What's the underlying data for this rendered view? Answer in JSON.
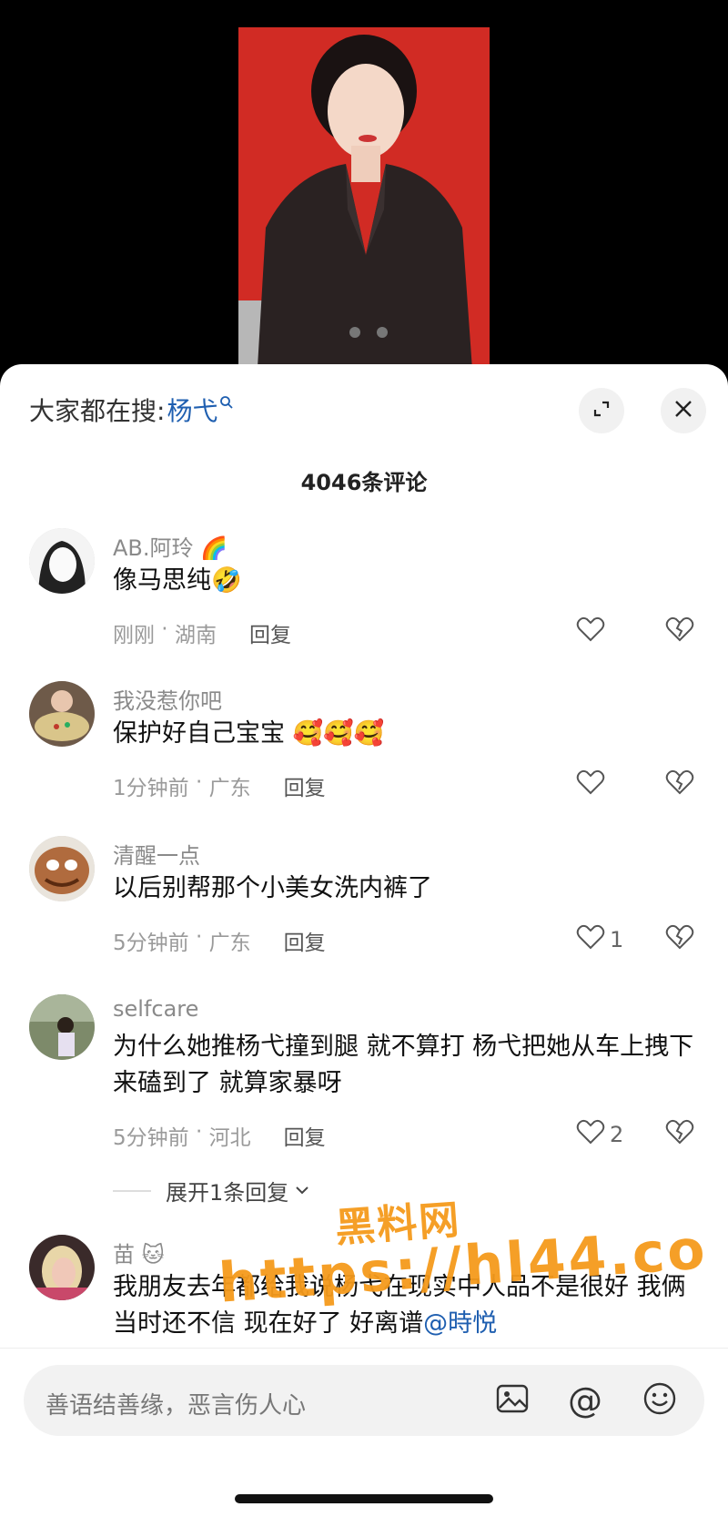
{
  "search": {
    "prefix": "大家都在搜:",
    "keyword": "杨弋"
  },
  "comment_count": "4046条评论",
  "comments": [
    {
      "username": "AB.阿玲",
      "text": "像马思纯",
      "time": "刚刚",
      "location": "湖南",
      "reply": "回复",
      "likes": ""
    },
    {
      "username": "我没惹你吧",
      "text": "保护好自己宝宝",
      "time": "1分钟前",
      "location": "广东",
      "reply": "回复",
      "likes": ""
    },
    {
      "username": "清醒一点",
      "text": "以后别帮那个小美女洗内裤了",
      "time": "5分钟前",
      "location": "广东",
      "reply": "回复",
      "likes": "1"
    },
    {
      "username": "selfcare",
      "text": "为什么她推杨弋撞到腿 就不算打 杨弋把她从车上拽下来磕到了 就算家暴呀",
      "time": "5分钟前",
      "location": "河北",
      "reply": "回复",
      "likes": "2"
    },
    {
      "username": "苗",
      "text": "我朋友去年都给我说杨弋在现实中人品不是很好 我俩当时还不信 现在好了 好离谱",
      "mention": "@時悦"
    }
  ],
  "expand_replies": "展开1条回复",
  "watermark": {
    "line1": "黑料网",
    "line2": "https://hl44.co"
  },
  "input": {
    "placeholder": "善语结善缘，恶言伤人心",
    "at_symbol": "@"
  },
  "colors": {
    "link": "#1f5fb0",
    "watermark": "#f59a1c",
    "photo_bg": "#d12b24"
  },
  "icons": [
    "search-icon",
    "expand-icon",
    "close-icon",
    "heart-icon",
    "broken-heart-icon",
    "image-icon",
    "at-icon",
    "emoji-icon"
  ]
}
